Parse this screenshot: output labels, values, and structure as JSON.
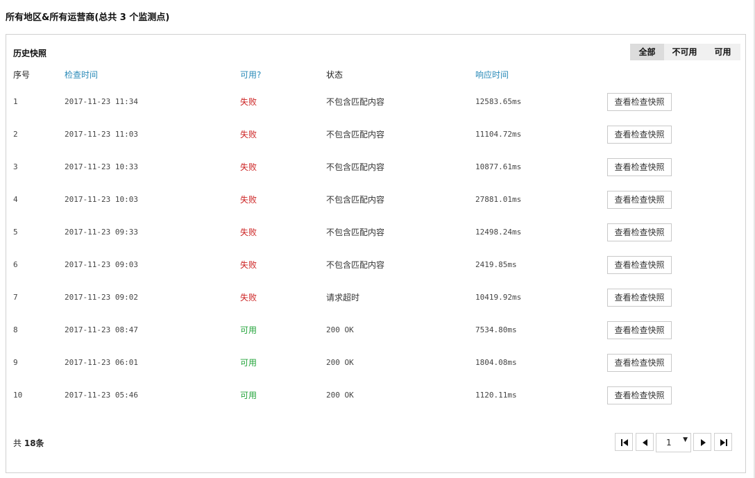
{
  "page": {
    "title": "所有地区&所有运营商(总共 3 个监测点)"
  },
  "panel": {
    "title": "历史快照",
    "filters": [
      {
        "label": "全部",
        "active": true
      },
      {
        "label": "不可用",
        "active": false
      },
      {
        "label": "可用",
        "active": false
      }
    ]
  },
  "table": {
    "headers": {
      "index": "序号",
      "check_time": "检查时间",
      "available": "可用?",
      "status": "状态",
      "response_time": "响应时间"
    },
    "rows": [
      {
        "index": "1",
        "time": "2017-11-23 11:34",
        "available": "失败",
        "ok": false,
        "status": "不包含匹配内容",
        "response": "12583.65ms",
        "action": "查看检查快照"
      },
      {
        "index": "2",
        "time": "2017-11-23 11:03",
        "available": "失败",
        "ok": false,
        "status": "不包含匹配内容",
        "response": "11104.72ms",
        "action": "查看检查快照"
      },
      {
        "index": "3",
        "time": "2017-11-23 10:33",
        "available": "失败",
        "ok": false,
        "status": "不包含匹配内容",
        "response": "10877.61ms",
        "action": "查看检查快照"
      },
      {
        "index": "4",
        "time": "2017-11-23 10:03",
        "available": "失败",
        "ok": false,
        "status": "不包含匹配内容",
        "response": "27881.01ms",
        "action": "查看检查快照"
      },
      {
        "index": "5",
        "time": "2017-11-23 09:33",
        "available": "失败",
        "ok": false,
        "status": "不包含匹配内容",
        "response": "12498.24ms",
        "action": "查看检查快照"
      },
      {
        "index": "6",
        "time": "2017-11-23 09:03",
        "available": "失败",
        "ok": false,
        "status": "不包含匹配内容",
        "response": "2419.85ms",
        "action": "查看检查快照"
      },
      {
        "index": "7",
        "time": "2017-11-23 09:02",
        "available": "失败",
        "ok": false,
        "status": "请求超时",
        "response": "10419.92ms",
        "action": "查看检查快照"
      },
      {
        "index": "8",
        "time": "2017-11-23 08:47",
        "available": "可用",
        "ok": true,
        "status": "200 OK",
        "response": "7534.80ms",
        "action": "查看检查快照"
      },
      {
        "index": "9",
        "time": "2017-11-23 06:01",
        "available": "可用",
        "ok": true,
        "status": "200 OK",
        "response": "1804.08ms",
        "action": "查看检查快照"
      },
      {
        "index": "10",
        "time": "2017-11-23 05:46",
        "available": "可用",
        "ok": true,
        "status": "200 OK",
        "response": "1120.11ms",
        "action": "查看检查快照"
      }
    ]
  },
  "footer": {
    "total_prefix": "共",
    "total_count": "18条",
    "current_page": "1"
  },
  "colors": {
    "link": "#2a8ab8",
    "fail": "#cc2222",
    "ok": "#22a33a"
  }
}
